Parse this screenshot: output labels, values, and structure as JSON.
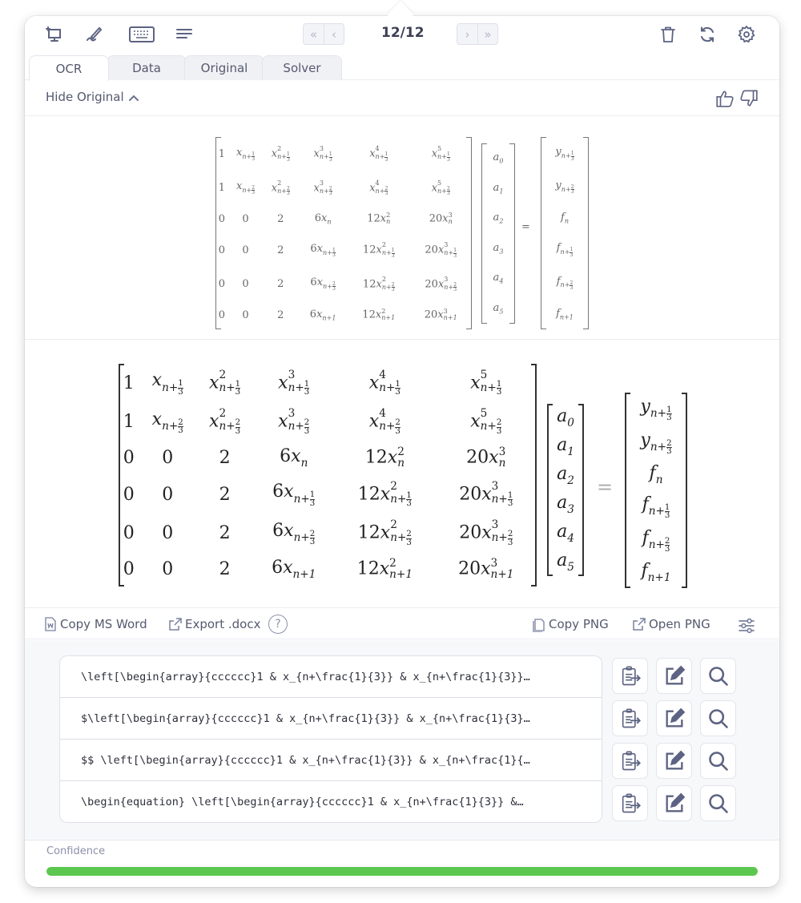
{
  "toolbar": {
    "left_icons": [
      "snip-screen-icon",
      "handwriting-icon",
      "keyboard-icon",
      "text-lines-icon"
    ],
    "nav": {
      "first": "«",
      "prev": "‹",
      "next": "›",
      "last": "»"
    },
    "page_counter": "12/12",
    "right_icons": [
      "trash-icon",
      "refresh-icon",
      "gear-icon"
    ]
  },
  "tabs": [
    {
      "label": "OCR",
      "active": true
    },
    {
      "label": "Data",
      "active": false
    },
    {
      "label": "Original",
      "active": false
    },
    {
      "label": "Solver",
      "active": false
    }
  ],
  "hide_original": {
    "label": "Hide Original",
    "chevron": "^"
  },
  "feedback": [
    "thumbs-up-icon",
    "thumbs-down-icon"
  ],
  "equation": {
    "matrix": [
      [
        "1",
        "x_{n+1/3}",
        "x^2_{n+1/3}",
        "x^3_{n+1/3}",
        "x^4_{n+1/3}",
        "x^5_{n+1/3}"
      ],
      [
        "1",
        "x_{n+2/3}",
        "x^2_{n+2/3}",
        "x^3_{n+2/3}",
        "x^4_{n+2/3}",
        "x^5_{n+2/3}"
      ],
      [
        "0",
        "0",
        "2",
        "6x_n",
        "12x^2_n",
        "20x^3_n"
      ],
      [
        "0",
        "0",
        "2",
        "6x_{n+1/3}",
        "12x^2_{n+1/3}",
        "20x^3_{n+1/3}"
      ],
      [
        "0",
        "0",
        "2",
        "6x_{n+2/3}",
        "12x^2_{n+2/3}",
        "20x^3_{n+2/3}"
      ],
      [
        "0",
        "0",
        "2",
        "6x_{n+1}",
        "12x^2_{n+1}",
        "20x^3_{n+1}"
      ]
    ],
    "unknowns": [
      "a_0",
      "a_1",
      "a_2",
      "a_3",
      "a_4",
      "a_5"
    ],
    "equals": "=",
    "rhs": [
      "y_{n+1/3}",
      "y_{n+2/3}",
      "f_n",
      "f_{n+1/3}",
      "f_{n+2/3}",
      "f_{n+1}"
    ]
  },
  "actions": {
    "copy_ms_word": "Copy MS Word",
    "export_docx": "Export .docx",
    "help": "?",
    "copy_png": "Copy PNG",
    "open_png": "Open PNG"
  },
  "latex_results": [
    "\\left[\\begin{array}{cccccc}1 & x_{n+\\frac{1}{3}} & x_{n+\\frac{1}{3}}…",
    "$\\left[\\begin{array}{cccccc}1 & x_{n+\\frac{1}{3}} & x_{n+\\frac{1}{3}…",
    "$$ \\left[\\begin{array}{cccccc}1 & x_{n+\\frac{1}{3}} & x_{n+\\frac{1}{…",
    "\\begin{equation} \\left[\\begin{array}{cccccc}1 & x_{n+\\frac{1}{3}} &…"
  ],
  "row_buttons": [
    "paste-clipboard-icon",
    "edit-icon",
    "search-icon"
  ],
  "confidence": {
    "label": "Confidence",
    "value": 1.0,
    "color": "#5bc74f"
  }
}
